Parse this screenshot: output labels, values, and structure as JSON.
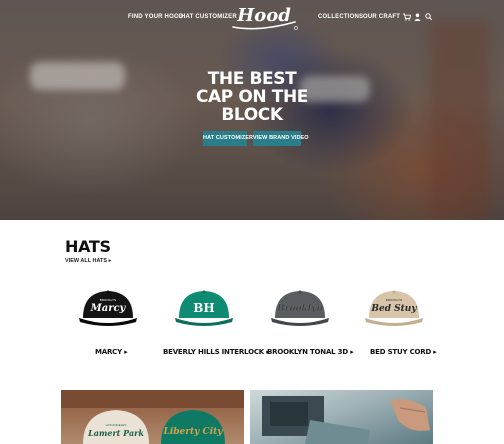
{
  "nav": {
    "find_your_hood": "FIND YOUR HOOD",
    "hat_customizer": "HAT CUSTOMIZER",
    "logo_text": "Hood",
    "collections": "COLLECTIONS",
    "our_craft": "OUR CRAFT",
    "icons": [
      "cart-icon",
      "user-icon",
      "search-icon"
    ]
  },
  "hero": {
    "title_line1": "THE BEST",
    "title_line2": "CAP ON THE",
    "title_line3": "BLOCK",
    "btn_customizer": "HAT CUSTOMIZER",
    "btn_video": "VIEW BRAND VIDEO"
  },
  "hats": {
    "title": "HATS",
    "view_all": "VIEW ALL HATS ▸",
    "items": [
      {
        "label": "MARCY ▸",
        "cap_text": "Marcy",
        "cap_top": "BROOKLYN",
        "color": "#141414",
        "text_color": "#ffffff"
      },
      {
        "label": "BEVERLY HILLS INTERLOCK ▸",
        "cap_text": "BH",
        "cap_top": "",
        "color": "#0f8a73",
        "text_color": "#ffffff"
      },
      {
        "label": "BROOKLYN TONAL 3D ▸",
        "cap_text": "Brooklyn",
        "cap_top": "",
        "color": "#5b5e61",
        "text_color": "#3c3e40"
      },
      {
        "label": "BED STUY CORD ▸",
        "cap_text": "Bed Stuy",
        "cap_top": "BROOKLYN",
        "color": "#d8c4a8",
        "text_color": "#2a2a2a"
      }
    ]
  },
  "features": {
    "left_cap1_text": "Lamert Park",
    "left_cap1_top": "LOS ANGELES",
    "left_cap2_text": "Liberty City"
  },
  "colors": {
    "accent": "#2a7e8a"
  }
}
